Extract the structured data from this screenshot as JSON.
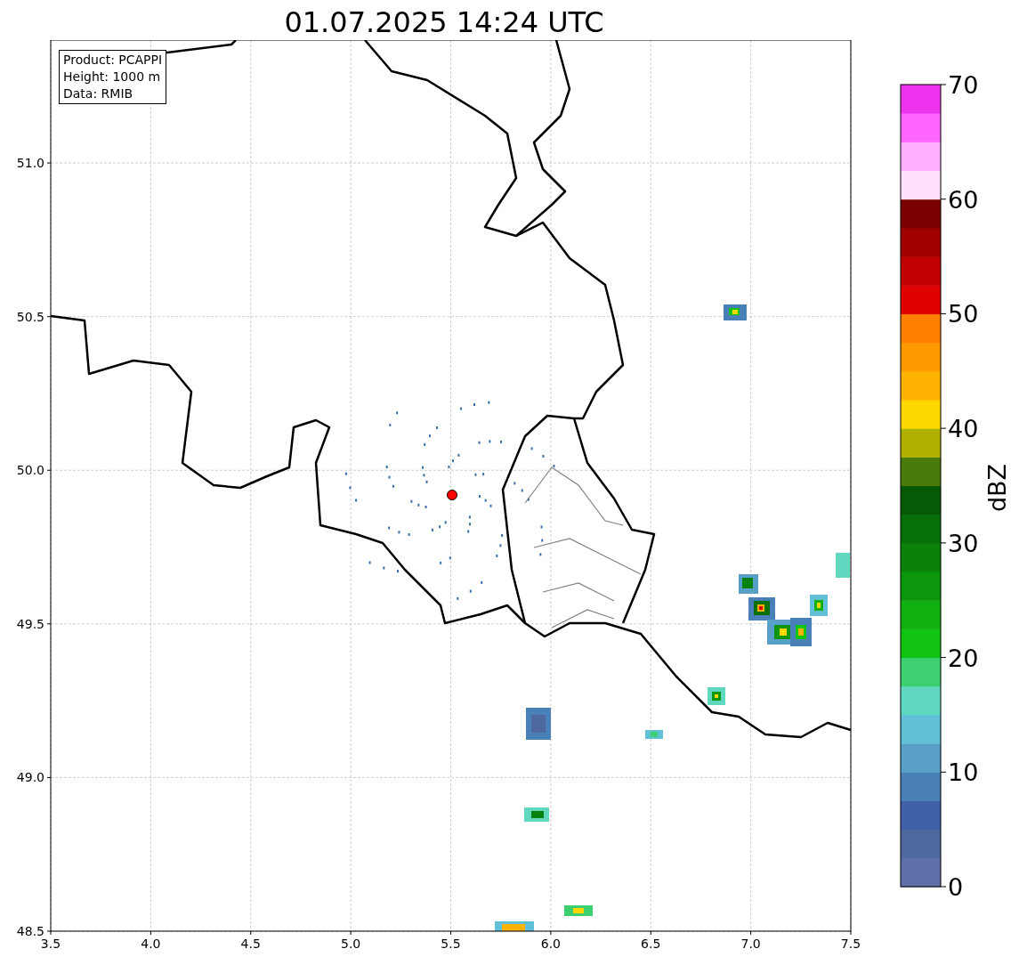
{
  "title": "01.07.2025 14:24 UTC",
  "info_box": [
    "Product: PCAPPI",
    "Height: 1000 m",
    "Data: RMIB"
  ],
  "map": {
    "xticks": [
      "3.5",
      "4.0",
      "4.5",
      "5.0",
      "5.5",
      "6.0",
      "6.5",
      "7.0",
      "7.5"
    ],
    "yticks": [
      "51.0",
      "50.5",
      "50.0",
      "49.5",
      "49.0",
      "48.5"
    ]
  },
  "colorbar": {
    "label": "dBZ",
    "ticks": [
      "70",
      "60",
      "50",
      "40",
      "30",
      "20",
      "10",
      "0"
    ],
    "segments": [
      {
        "color": "#6070a8"
      },
      {
        "color": "#5068a0"
      },
      {
        "color": "#4060a8"
      },
      {
        "color": "#4a80b8"
      },
      {
        "color": "#58a0c8"
      },
      {
        "color": "#60c0d8"
      },
      {
        "color": "#60d8c0"
      },
      {
        "color": "#3cd070"
      },
      {
        "color": "#12c412"
      },
      {
        "color": "#10b010"
      },
      {
        "color": "#0c960c"
      },
      {
        "color": "#0a820a"
      },
      {
        "color": "#087008"
      },
      {
        "color": "#065a06"
      },
      {
        "color": "#4a7a0a"
      },
      {
        "color": "#b0b000"
      },
      {
        "color": "#ffd700"
      },
      {
        "color": "#ffb300"
      },
      {
        "color": "#ff9900"
      },
      {
        "color": "#ff7f00"
      },
      {
        "color": "#e00000"
      },
      {
        "color": "#c00000"
      },
      {
        "color": "#a00000"
      },
      {
        "color": "#780000"
      },
      {
        "color": "#ffe0ff"
      },
      {
        "color": "#ffb0ff"
      },
      {
        "color": "#ff66ff"
      },
      {
        "color": "#ee33ee"
      }
    ]
  }
}
